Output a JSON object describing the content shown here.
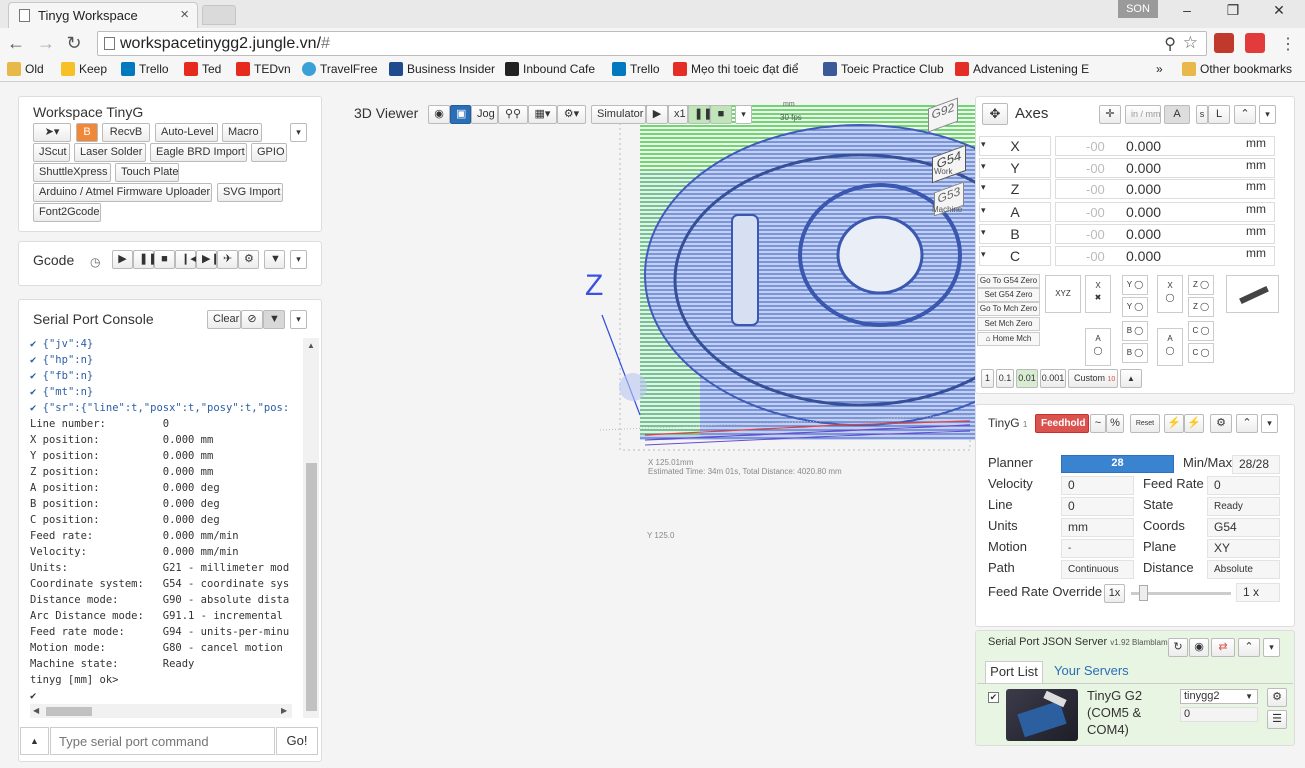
{
  "browser": {
    "tab_title": "Tinyg Workspace",
    "tab_close": "×",
    "user": "SON",
    "window_buttons": [
      "–",
      "❐",
      "✕"
    ],
    "url": "workspacetinygg2.jungle.vn/",
    "url_hash": "#"
  },
  "bookmarks": [
    {
      "label": "Old",
      "icon": "folder-icon",
      "color": "#e8b94a"
    },
    {
      "label": "Keep",
      "icon": "keep-icon",
      "color": "#f6c026"
    },
    {
      "label": "Trello",
      "icon": "trello-icon",
      "color": "#0079bf"
    },
    {
      "label": "Ted",
      "icon": "ted-icon",
      "color": "#e62b1e"
    },
    {
      "label": "TEDvn",
      "icon": "tedvn-icon",
      "color": "#e62b1e"
    },
    {
      "label": "TravelFree",
      "icon": "travelfree-icon",
      "color": "#3aa0d8"
    },
    {
      "label": "Business Insider",
      "icon": "bi-icon",
      "color": "#1f4b8e"
    },
    {
      "label": "Inbound Cafe",
      "icon": "inbound-icon",
      "color": "#222222"
    },
    {
      "label": "Trello",
      "icon": "trello-icon",
      "color": "#0079bf"
    },
    {
      "label": "Mẹo thi toeic đạt điể",
      "icon": "youtube-icon",
      "color": "#e52d27"
    },
    {
      "label": "Toeic Practice Club",
      "icon": "facebook-icon",
      "color": "#3b5998"
    },
    {
      "label": "Advanced Listening E",
      "icon": "youtube-icon",
      "color": "#e52d27"
    }
  ],
  "bookmarks_more": "»",
  "other_bookmarks": "Other bookmarks",
  "workspace": {
    "title": "Workspace TinyG",
    "buttons": [
      "RecvB",
      "Auto-Level",
      "Macro",
      "JScut",
      "Laser Solder",
      "Eagle BRD Import",
      "GPIO",
      "ShuttleXpress",
      "Touch Plate",
      "Arduino / Atmel Firmware Uploader",
      "SVG Import",
      "Font2Gcode"
    ]
  },
  "gcode": {
    "title": "Gcode"
  },
  "console": {
    "title": "Serial Port Console",
    "clear": "Clear",
    "json_lines": [
      "{\"jv\":4}",
      "{\"hp\":n}",
      "{\"fb\":n}",
      "{\"mt\":n}",
      "{\"sr\":{\"line\":t,\"posx\":t,\"posy\":t,\"pos:"
    ],
    "lines": [
      "Line number:         0",
      "X position:          0.000 mm",
      "Y position:          0.000 mm",
      "Z position:          0.000 mm",
      "A position:          0.000 deg",
      "B position:          0.000 deg",
      "C position:          0.000 deg",
      "Feed rate:           0.000 mm/min",
      "Velocity:            0.000 mm/min",
      "Units:               G21 - millimeter mod",
      "Coordinate system:   G54 - coordinate sys",
      "Distance mode:       G90 - absolute dista",
      "Arc Distance mode:   G91.1 - incremental",
      "Feed rate mode:      G94 - units-per-minu",
      "Motion mode:         G80 - cancel motion",
      "Machine state:       Ready",
      "tinyg [mm] ok>",
      "✔"
    ],
    "placeholder": "Type serial port command",
    "go": "Go!"
  },
  "viewer": {
    "title": "3D Viewer",
    "jog": "Jog",
    "simulator": "Simulator",
    "speed": "x1",
    "axis_label": "Z",
    "fps": "30 fps",
    "mm": "mm",
    "cube": [
      "G92",
      "G54",
      "G53",
      "Work",
      "Machine"
    ],
    "dims": "X 125.01mm",
    "dims_y": "Y 125.0",
    "estimate": "Estimated Time: 34m 01s, Total Distance: 4020.80 mm"
  },
  "axes": {
    "title": "Axes",
    "units_btn": "in / mm",
    "rows": [
      {
        "axis": "X",
        "dim": "-00",
        "value": "0.000",
        "unit": "mm"
      },
      {
        "axis": "Y",
        "dim": "-00",
        "value": "0.000",
        "unit": "mm"
      },
      {
        "axis": "Z",
        "dim": "-00",
        "value": "0.000",
        "unit": "mm"
      },
      {
        "axis": "A",
        "dim": "-00",
        "value": "0.000",
        "unit": "mm"
      },
      {
        "axis": "B",
        "dim": "-00",
        "value": "0.000",
        "unit": "mm"
      },
      {
        "axis": "C",
        "dim": "-00",
        "value": "0.000",
        "unit": "mm"
      }
    ],
    "goto_buttons": [
      "Go To G54 Zero",
      "Set G54 Zero",
      "Go To Mch Zero",
      "Set Mch Zero",
      "Home Mch"
    ],
    "xyz_label": "XYZ",
    "jog_labels": [
      "X",
      "Y",
      "Y",
      "X",
      "Z",
      "Z",
      "A",
      "B",
      "B",
      "A",
      "C",
      "C"
    ],
    "steps": [
      "1",
      "0.1",
      "0.01",
      "0.001",
      "Custom"
    ],
    "custom_value": "10"
  },
  "tinyg": {
    "title": "TinyG",
    "title_num": "1",
    "feedhold": "Feedhold !",
    "tilde": "~",
    "percent": "%",
    "reset": "Reset",
    "planner_label": "Planner",
    "planner_value": "28",
    "planner_fill": 1.0,
    "minmax_label": "Min/Max",
    "minmax_value": "28/28",
    "velocity_label": "Velocity",
    "velocity": "0",
    "feed_label": "Feed Rate",
    "feed": "0",
    "line_label": "Line",
    "line": "0",
    "state_label": "State",
    "state": "Ready",
    "units_label": "Units",
    "units": "mm",
    "coords_label": "Coords",
    "coords": "G54",
    "motion_label": "Motion",
    "motion": "-",
    "plane_label": "Plane",
    "plane": "XY",
    "path_label": "Path",
    "path": "Continuous",
    "distance_label": "Distance",
    "distance": "Absolute",
    "override_label": "Feed Rate Override",
    "override_small": "1x",
    "override_value": "1 x"
  },
  "spjs": {
    "title": "Serial Port JSON Server",
    "version": "v1.92 Blamblam",
    "tab_ports": "Port List",
    "tab_servers": "Your Servers",
    "device_name": "TinyG G2",
    "device_port": "(COM5 &",
    "device_port2": "COM4)",
    "select": "tinygg2",
    "baud": "0"
  }
}
